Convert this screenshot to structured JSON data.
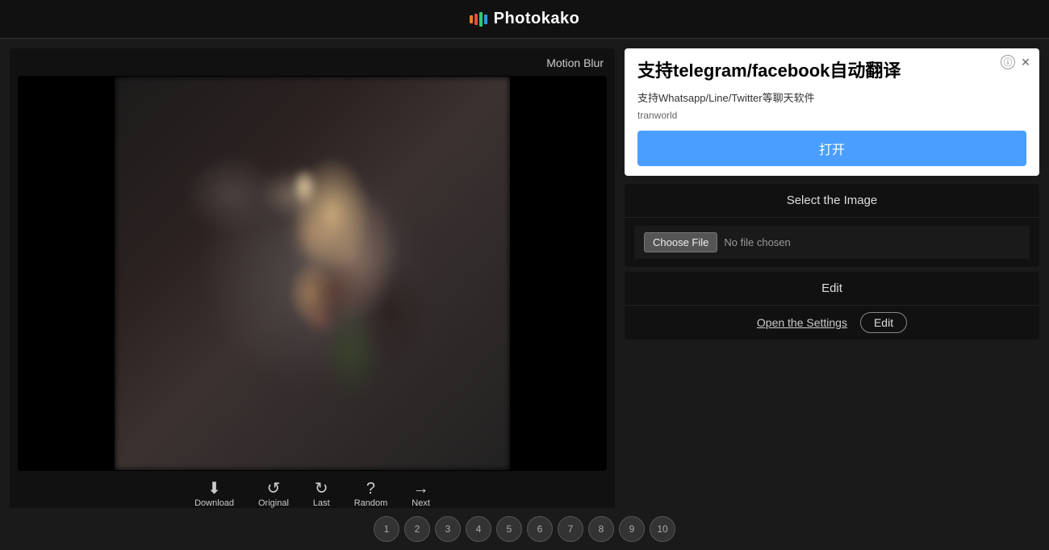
{
  "header": {
    "title": "Photokako",
    "logo_icon": "bar-chart-icon"
  },
  "left_panel": {
    "title": "Motion Blur"
  },
  "toolbar": {
    "items": [
      {
        "id": "download",
        "icon": "⬇",
        "label": "Download"
      },
      {
        "id": "original",
        "icon": "↺",
        "label": "Original"
      },
      {
        "id": "last",
        "icon": "↻",
        "label": "Last"
      },
      {
        "id": "random",
        "icon": "?",
        "label": "Random"
      },
      {
        "id": "next",
        "icon": "→",
        "label": "Next"
      }
    ]
  },
  "ad": {
    "heading": "支持telegram/facebook自动翻译",
    "subtext": "支持Whatsapp/Line/Twitter等聊天软件",
    "brand": "tranworld",
    "cta_label": "打开"
  },
  "select_image": {
    "header": "Select the Image",
    "choose_file_label": "Choose File",
    "no_file_label": "No file chosen"
  },
  "edit_section": {
    "header": "Edit",
    "open_settings_label": "Open the Settings",
    "edit_button_label": "Edit"
  },
  "bottom_dots": [
    1,
    2,
    3,
    4,
    5,
    6,
    7,
    8,
    9,
    10
  ]
}
